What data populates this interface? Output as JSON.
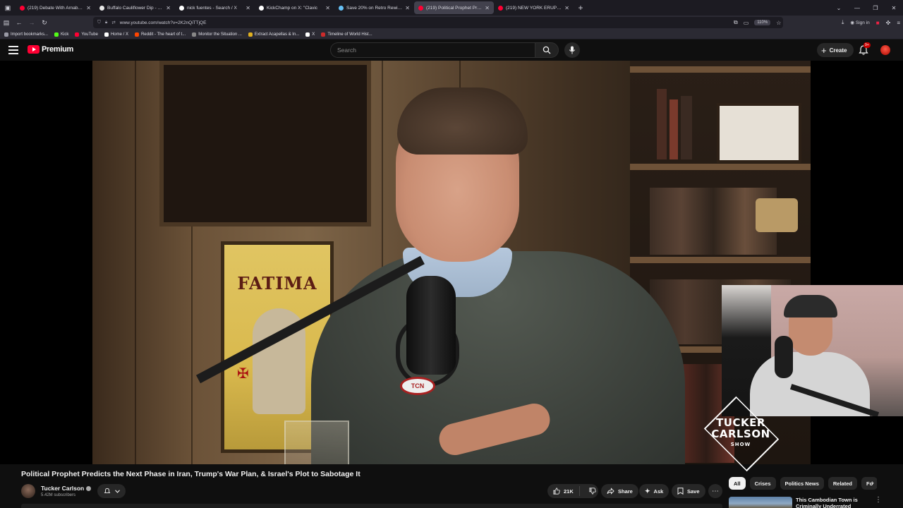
{
  "browser": {
    "tabs": [
      {
        "title": "(219) Debate With Arnab LIVE:",
        "favicon_color": "#ff0033"
      },
      {
        "title": "Buffalo Cauliflower Dip - Gimm",
        "favicon_color": "#e8e8e8"
      },
      {
        "title": "nick fuentes - Search / X",
        "favicon_color": "#ffffff"
      },
      {
        "title": "KickChamp on X: \"Clavic",
        "favicon_color": "#ffffff"
      },
      {
        "title": "Save 20% on Retro Rewind - Vi",
        "favicon_color": "#66c0f4"
      },
      {
        "title": "(219) Political Prophet Pred",
        "favicon_color": "#ff0033",
        "active": true
      },
      {
        "title": "(219) NEW YORK ERUPTS: Prote",
        "favicon_color": "#ff0033"
      }
    ],
    "url": "www.youtube.com/watch?v=2K2nQiTTjQE",
    "zoom": "110%",
    "signin_label": "Sign in",
    "bookmarks": [
      {
        "label": "Import bookmarks...",
        "color": "#9a9aa6"
      },
      {
        "label": "Kick",
        "color": "#53fc18"
      },
      {
        "label": "YouTube",
        "color": "#ff0033"
      },
      {
        "label": "Home / X",
        "color": "#ffffff"
      },
      {
        "label": "Reddit - The heart of t...",
        "color": "#ff4500"
      },
      {
        "label": "Monitor the Situation ...",
        "color": "#888888"
      },
      {
        "label": "Extract Acapellas & In...",
        "color": "#e0b020"
      },
      {
        "label": "X",
        "color": "#ffffff"
      },
      {
        "label": "Timeline of World Hist...",
        "color": "#cc2b2b"
      }
    ]
  },
  "youtube": {
    "brand": "Premium",
    "search_placeholder": "Search",
    "create_label": "Create",
    "notif_badge": "9+",
    "video": {
      "mic_logo": "TCN",
      "poster_text": "FATIMA",
      "show_logo": {
        "line1": "TUCKER",
        "line2": "CARLSON",
        "line3": "SHOW"
      }
    },
    "title": "Political Prophet Predicts the Next Phase in Iran, Trump's War Plan, & Israel's Plot to Sabotage It",
    "channel": {
      "name": "Tucker Carlson",
      "subscribers": "5.42M subscribers"
    },
    "actions": {
      "likes": "21K",
      "share": "Share",
      "ask": "Ask",
      "save": "Save"
    },
    "chips": [
      "All",
      "Crises",
      "Politics News",
      "Related",
      "Fo"
    ],
    "recommendation": {
      "title": "This Cambodian Town is Criminally Underrated"
    }
  }
}
